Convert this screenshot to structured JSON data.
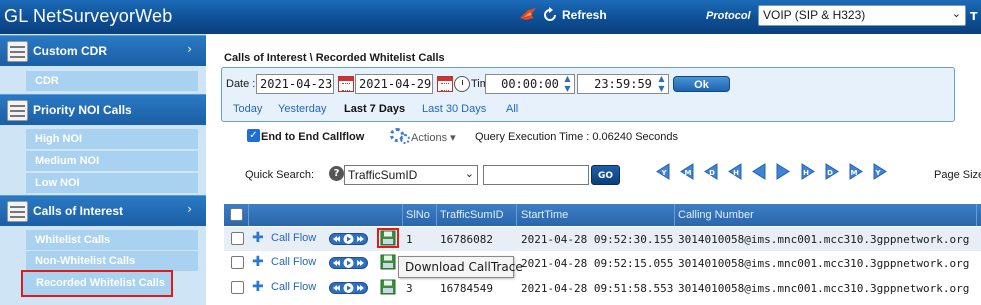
{
  "app": {
    "title": "GL NetSurveyorWeb"
  },
  "header": {
    "refresh_label": "Refresh",
    "protocol_label": "Protocol",
    "protocol_value": "VOIP (SIP & H323)",
    "trailing": "T"
  },
  "sidebar": {
    "sections": [
      {
        "label": "Custom CDR",
        "items": [
          "CDR"
        ]
      },
      {
        "label": "Priority NOI Calls",
        "items": [
          "High NOI",
          "Medium NOI",
          "Low NOI"
        ]
      },
      {
        "label": "Calls of Interest",
        "items": [
          "Whitelist Calls",
          "Non-Whitelist Calls",
          "Recorded Whitelist Calls"
        ]
      }
    ],
    "active_item": "Recorded Whitelist Calls"
  },
  "main": {
    "breadcrumb": "Calls of Interest \\ Recorded Whitelist Calls",
    "date_label": "Date :",
    "date_from": "2021-04-23",
    "date_to": "2021-04-29",
    "time_label": "Time :",
    "time_from": "00:00:00",
    "time_to": "23:59:59",
    "ok_label": "Ok",
    "quick_ranges": [
      "Today",
      "Yesterday",
      "Last 7 Days",
      "Last 30 Days",
      "All"
    ],
    "active_range": "Last 7 Days",
    "end_to_end_label": "End to End Callflow",
    "end_to_end_checked": true,
    "actions_label": "Actions",
    "query_time": "Query Execution Time : 0.06240 Seconds",
    "quick_search_label": "Quick Search:",
    "quick_search_field": "TrafficSumID",
    "quick_search_value": "",
    "go_label": "GO",
    "nav_buttons": [
      "Y",
      "M",
      "D",
      "H",
      "prev",
      "next",
      "H",
      "D",
      "M",
      "Y"
    ],
    "page_size_label": "Page Size"
  },
  "table": {
    "columns": [
      "SlNo",
      "TrafficSumID",
      "StartTime",
      "Calling Number"
    ],
    "call_flow_label": "Call Flow",
    "rows": [
      {
        "slno": "1",
        "traffic_sum_id": "16786082",
        "start_time": "2021-04-28 09:52:30.155",
        "calling_number": "3014010058@ims.mnc001.mcc310.3gppnetwork.org"
      },
      {
        "slno": "2",
        "traffic_sum_id": "",
        "start_time": "2021-04-28 09:52:15.055",
        "calling_number": "3014010058@ims.mnc001.mcc310.3gppnetwork.org"
      },
      {
        "slno": "3",
        "traffic_sum_id": "16784549",
        "start_time": "2021-04-28 09:51:58.553",
        "calling_number": "3014010058@ims.mnc001.mcc310.3gppnetwork.org"
      }
    ]
  },
  "tooltip": {
    "text": "Download CallTrace"
  },
  "colors": {
    "header_blue": "#0e4f96",
    "sidebar_bg": "#cfe5f5",
    "link_blue": "#2567bb",
    "highlight_red": "#e01b1b"
  }
}
